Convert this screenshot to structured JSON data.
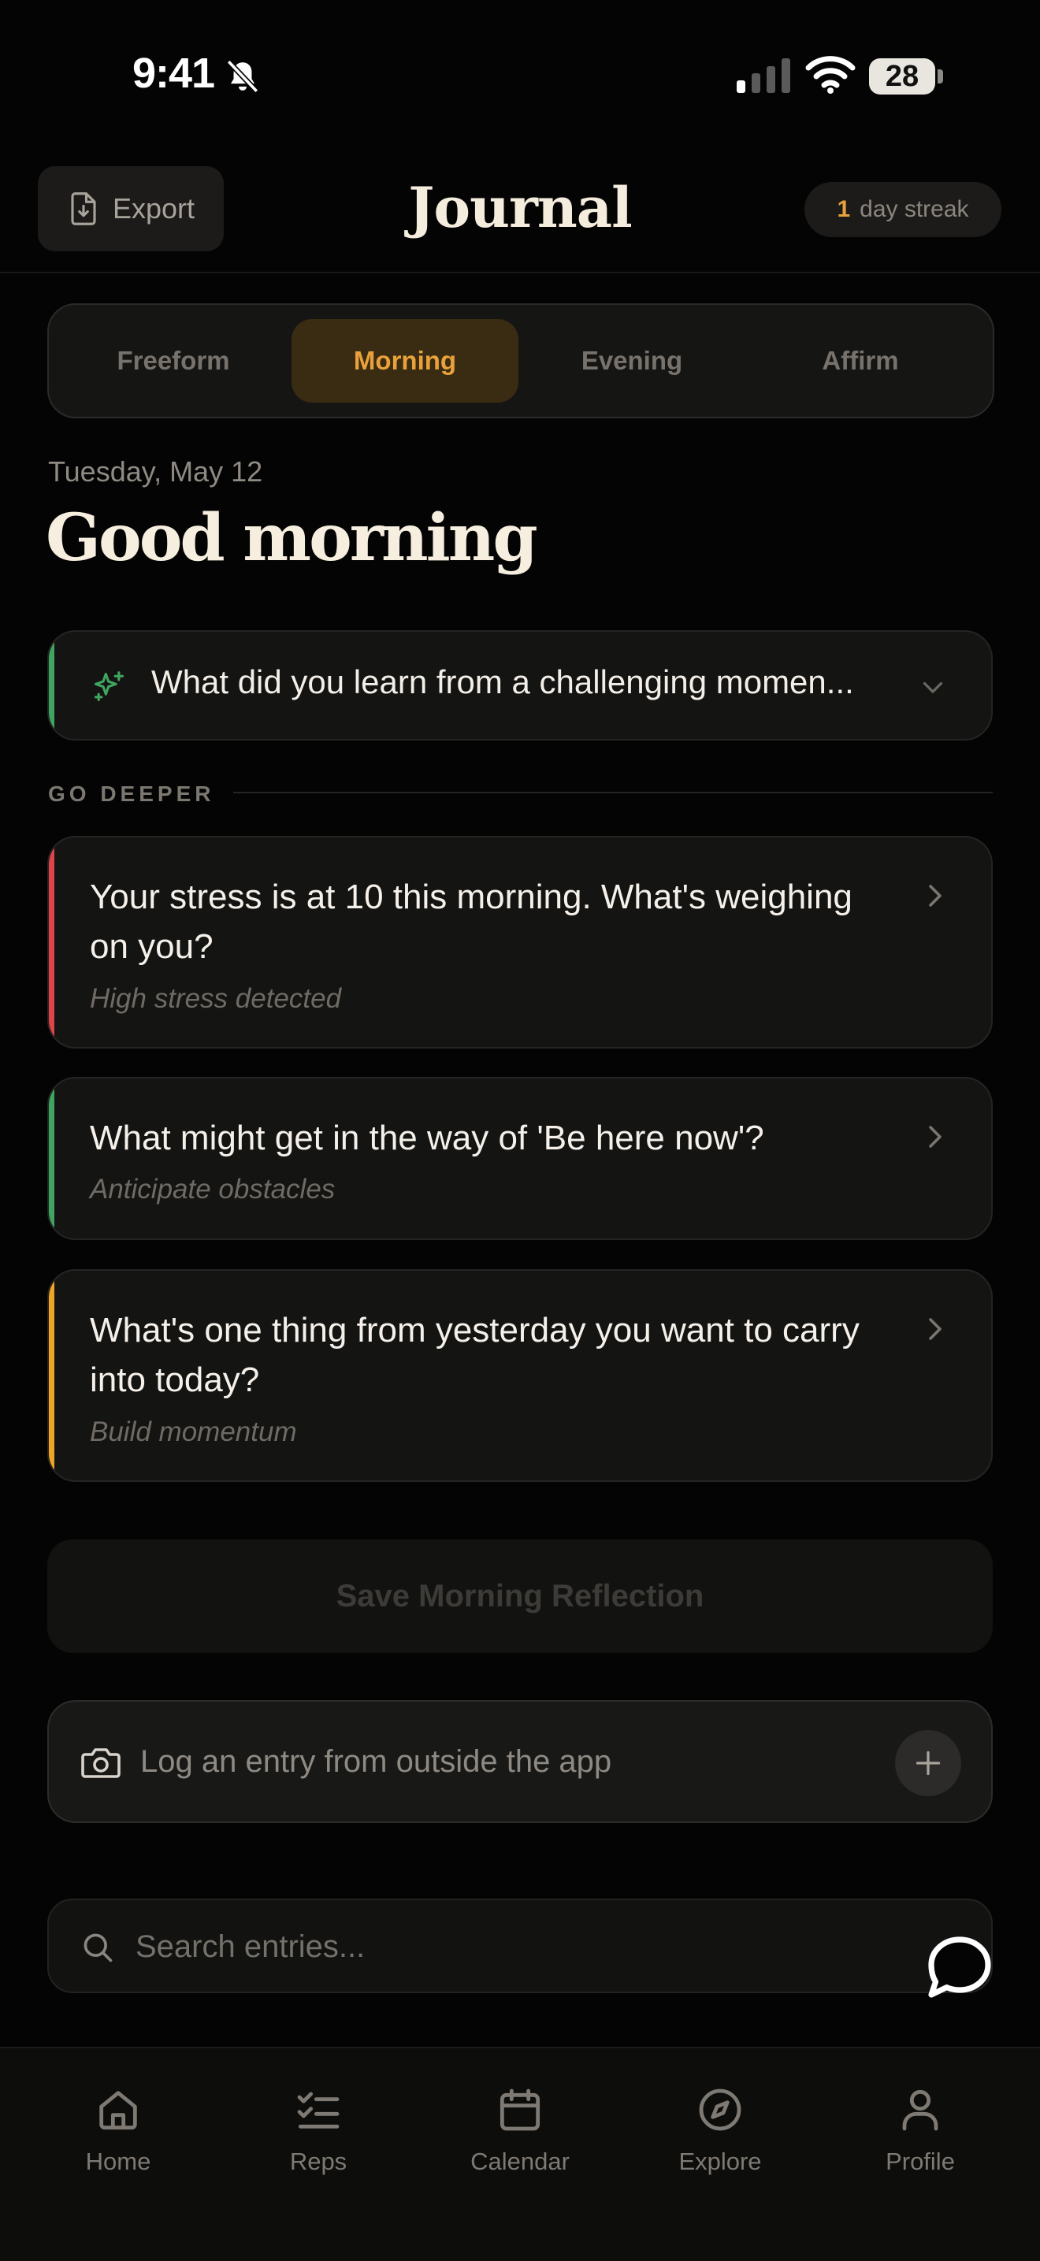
{
  "status_bar": {
    "time": "9:41",
    "battery": "28",
    "icons": [
      "bell-slash-icon",
      "cellular-signal-icon",
      "wifi-icon",
      "battery-icon"
    ]
  },
  "header": {
    "export_label": "Export",
    "title": "Journal",
    "streak_count": "1",
    "streak_label": "day streak"
  },
  "tabs": [
    {
      "label": "Freeform",
      "active": false
    },
    {
      "label": "Morning",
      "active": true
    },
    {
      "label": "Evening",
      "active": false
    },
    {
      "label": "Affirm",
      "active": false
    }
  ],
  "date": "Tuesday, May 12",
  "greeting": "Good morning",
  "prompt": {
    "text": "What did you learn from a challenging momen...",
    "accent": "#3fa661"
  },
  "go_deeper": {
    "label": "GO DEEPER",
    "items": [
      {
        "title": "Your stress is at 10 this morning. What's weighing on you?",
        "subtitle": "High stress detected",
        "accent": "#e0434a"
      },
      {
        "title": "What might get in the way of 'Be here now'?",
        "subtitle": "Anticipate obstacles",
        "accent": "#3fa661"
      },
      {
        "title": "What's one thing from yesterday you want to carry into today?",
        "subtitle": "Build momentum",
        "accent": "#eea425"
      }
    ]
  },
  "save_button": "Save Morning Reflection",
  "log_entry": {
    "text": "Log an entry from outside the app"
  },
  "search": {
    "placeholder": "Search entries..."
  },
  "nav": [
    {
      "label": "Home",
      "icon": "home-icon"
    },
    {
      "label": "Reps",
      "icon": "checklist-icon"
    },
    {
      "label": "Calendar",
      "icon": "calendar-icon"
    },
    {
      "label": "Explore",
      "icon": "compass-icon"
    },
    {
      "label": "Profile",
      "icon": "profile-icon"
    }
  ],
  "colors": {
    "accent_orange": "#e9a23b",
    "background": "#040404",
    "card": "#141413"
  }
}
